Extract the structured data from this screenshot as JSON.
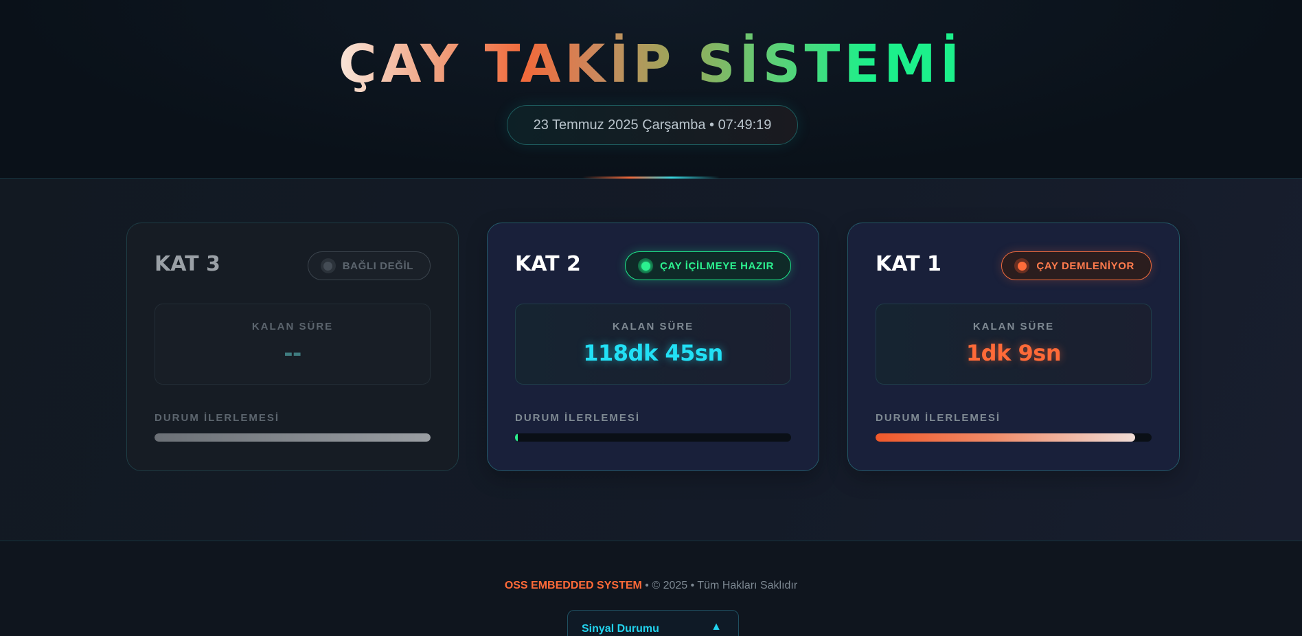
{
  "header": {
    "title": "ÇAY TAKİP SİSTEMİ",
    "datetime": "23 Temmuz 2025 Çarşamba • 07:49:19"
  },
  "floors": [
    {
      "name": "KAT 3",
      "status": "BAĞLI DEĞİL",
      "status_color": "#5c656e",
      "remaining_label": "KALAN SÜRE",
      "remaining": "--",
      "progress_label": "DURUM İLERLEMESİ",
      "progress": 1.0
    },
    {
      "name": "KAT 2",
      "status": "ÇAY İÇİLMEYE HAZIR",
      "status_color": "#2cf08f",
      "remaining_label": "KALAN SÜRE",
      "remaining": "118dk 45sn",
      "progress_label": "DURUM İLERLEMESİ",
      "progress": 0.01
    },
    {
      "name": "KAT 1",
      "status": "ÇAY DEMLENİYOR",
      "status_color": "#ff6a38",
      "remaining_label": "KALAN SÜRE",
      "remaining": "1dk 9sn",
      "progress_label": "DURUM İLERLEMESİ",
      "progress": 0.94
    }
  ],
  "footer": {
    "brand": "OSS EMBEDDED SYSTEM",
    "copyright": " • © 2025 • Tüm Hakları Saklıdır",
    "signal_title": "Sinyal Durumu",
    "signal_toggle_icon": "triangle-up-icon"
  }
}
